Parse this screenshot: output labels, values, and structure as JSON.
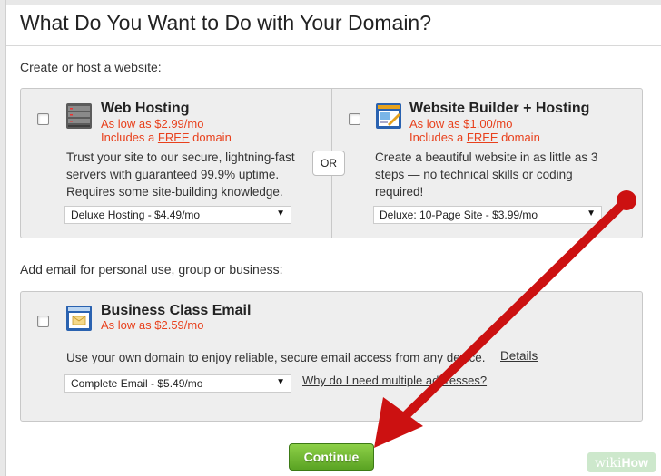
{
  "page": {
    "title": "What Do You Want to Do with Your Domain?"
  },
  "website_section": {
    "label": "Create or host a website:",
    "or_label": "OR",
    "products": [
      {
        "name": "Web Hosting",
        "price": "As low as $2.99/mo",
        "includes_prefix": "Includes a ",
        "includes_free": "FREE",
        "includes_suffix": " domain",
        "description": "Trust your site to our secure, lightning-fast servers with guaranteed 99.9% uptime. Requires some site-building knowledge.",
        "selected_option": "Deluxe Hosting - $4.49/mo",
        "icon": "server-icon"
      },
      {
        "name": "Website Builder + Hosting",
        "price": "As low as $1.00/mo",
        "includes_prefix": "Includes a ",
        "includes_free": "FREE",
        "includes_suffix": " domain",
        "description": "Create a beautiful website in as little as 3 steps — no technical skills or coding required!",
        "selected_option": "Deluxe: 10-Page Site - $3.99/mo",
        "icon": "website-builder-icon"
      }
    ]
  },
  "email_section": {
    "label": "Add email for personal use, group or business:",
    "product": {
      "name": "Business Class Email",
      "price": "As low as $2.59/mo",
      "description": "Use your own domain to enjoy reliable, secure email access from any device.",
      "details_link": "Details",
      "selected_option": "Complete Email - $5.49/mo",
      "help_link": "Why do I need multiple addresses?",
      "icon": "email-icon"
    }
  },
  "actions": {
    "continue_label": "Continue"
  },
  "watermark": {
    "wiki": "wiki",
    "how": "How"
  },
  "colors": {
    "price": "#e8401c",
    "continue_button": "#6bb52e",
    "annotation_arrow": "#cc1111"
  }
}
